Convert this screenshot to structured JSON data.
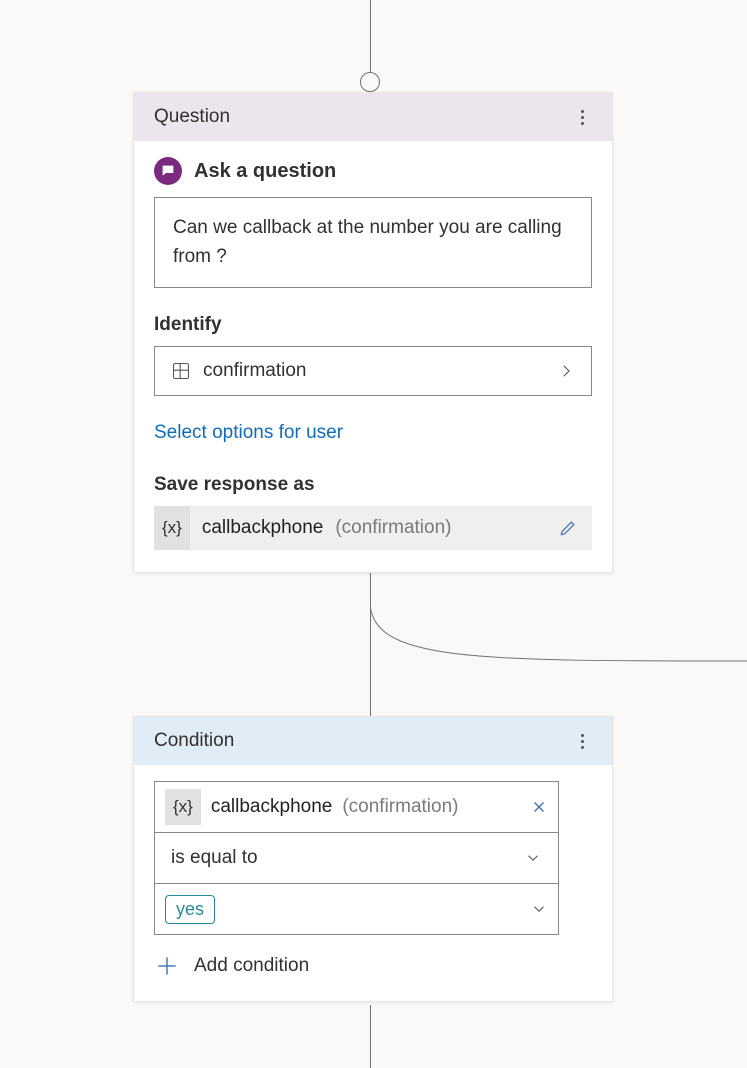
{
  "question_card": {
    "header": "Question",
    "ask_title": "Ask a question",
    "question_text": "Can we callback at the number you are calling from ?",
    "identify_label": "Identify",
    "identify_value": "confirmation",
    "options_link": "Select options for user",
    "save_label": "Save response as",
    "var_badge": "{x}",
    "var_name": "callbackphone",
    "var_type": "(confirmation)"
  },
  "condition_card": {
    "header": "Condition",
    "var_badge": "{x}",
    "var_name": "callbackphone",
    "var_type": "(confirmation)",
    "operator": "is equal to",
    "value": "yes",
    "add_label": "Add condition"
  }
}
